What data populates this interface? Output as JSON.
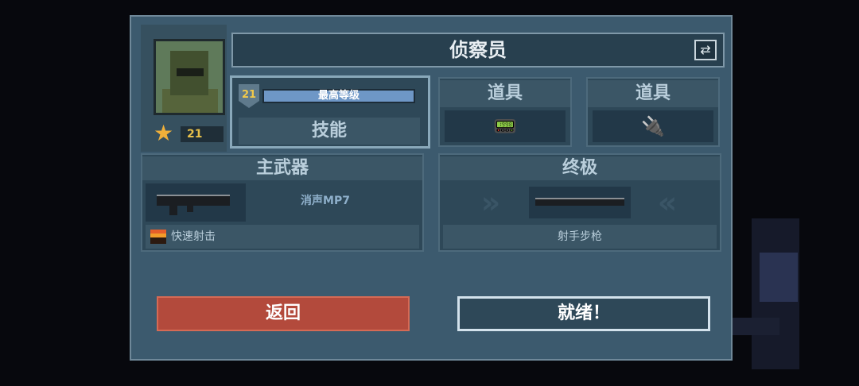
{
  "character": {
    "name": "侦察员",
    "star_level": "21"
  },
  "skill": {
    "level": "21",
    "level_status": "最高等级",
    "label": "技能"
  },
  "items": [
    {
      "title": "道具",
      "icon": "radio-device-icon"
    },
    {
      "title": "道具",
      "icon": "sensor-device-icon"
    }
  ],
  "primary_weapon": {
    "title": "主武器",
    "weapon_name": "消声MP7",
    "trait": "快速射击",
    "icon": "smg-icon"
  },
  "ultimate": {
    "title": "终极",
    "weapon_name": "射手步枪",
    "icon": "rifle-icon"
  },
  "buttons": {
    "back": "返回",
    "ready": "就绪！"
  },
  "colors": {
    "panel": "#3c5a6e",
    "back_button": "#b34a3c",
    "level_bar": "#6e97c6",
    "star": "#f0b03a"
  }
}
